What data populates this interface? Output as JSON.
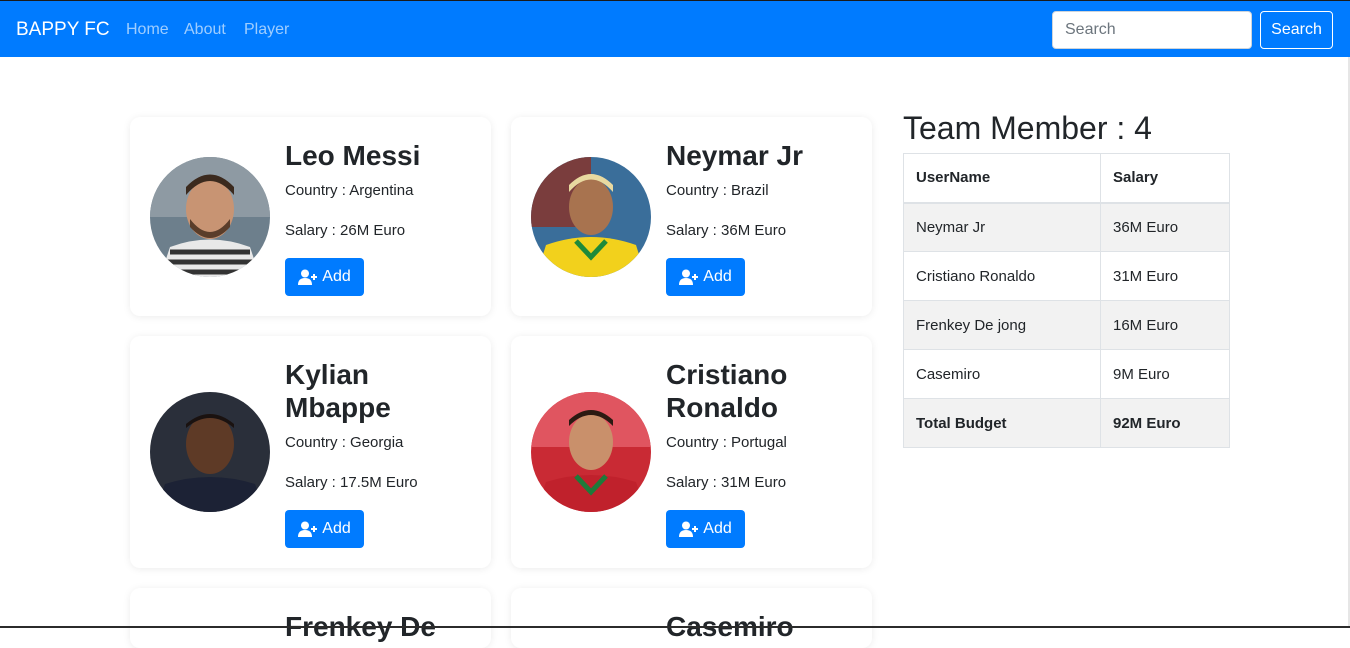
{
  "nav": {
    "brand": "BAPPY FC",
    "links": [
      "Home",
      "About",
      "Player"
    ],
    "search_placeholder": "Search",
    "search_button": "Search"
  },
  "players": [
    {
      "name": "Leo Messi",
      "country": "Country : Argentina",
      "salary": "Salary : 26M Euro",
      "add_label": "Add"
    },
    {
      "name": "Neymar Jr",
      "country": "Country : Brazil",
      "salary": "Salary : 36M Euro",
      "add_label": "Add"
    },
    {
      "name": "Kylian Mbappe",
      "country": "Country : Georgia",
      "salary": "Salary : 17.5M Euro",
      "add_label": "Add"
    },
    {
      "name": "Cristiano Ronaldo",
      "country": "Country : Portugal",
      "salary": "Salary : 31M Euro",
      "add_label": "Add"
    },
    {
      "name": "Frenkey De",
      "country": "",
      "salary": "",
      "add_label": ""
    },
    {
      "name": "Casemiro",
      "country": "",
      "salary": "",
      "add_label": ""
    }
  ],
  "team": {
    "title": "Team Member : 4",
    "headers": [
      "UserName",
      "Salary"
    ],
    "rows": [
      [
        "Neymar Jr",
        "36M Euro"
      ],
      [
        "Cristiano Ronaldo",
        "31M Euro"
      ],
      [
        "Frenkey De jong",
        "16M Euro"
      ],
      [
        "Casemiro",
        "9M Euro"
      ]
    ],
    "total": [
      "Total Budget",
      "92M Euro"
    ]
  },
  "colors": {
    "primary": "#007bff",
    "text": "#212529"
  }
}
